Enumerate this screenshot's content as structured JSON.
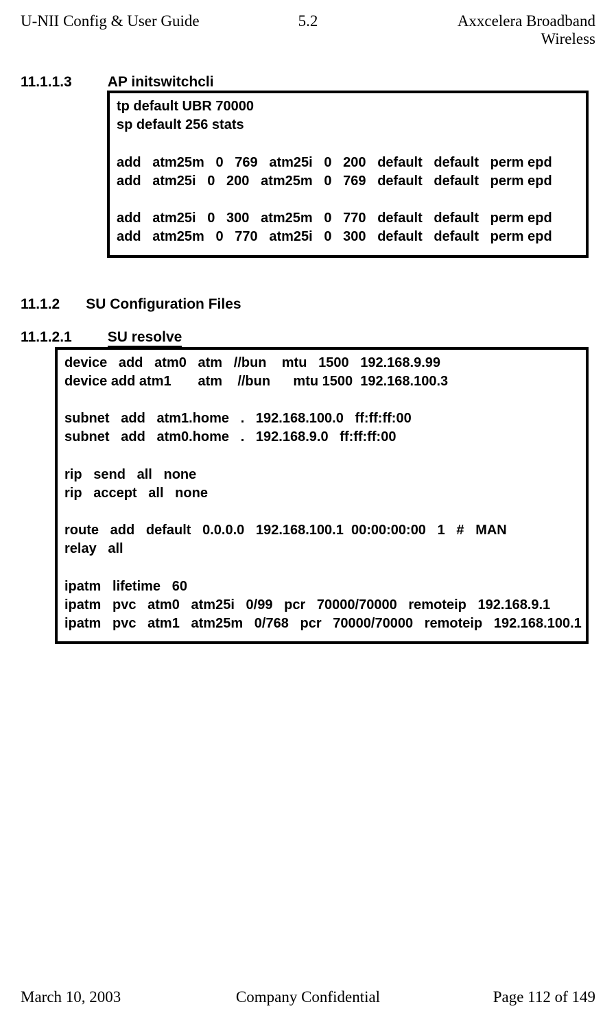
{
  "header": {
    "left": "U-NII Config & User Guide",
    "center": "5.2",
    "right": "Axxcelera Broadband Wireless"
  },
  "sections": {
    "s1": {
      "num": "11.1.1.3",
      "title": "AP initswitchcli"
    },
    "s2": {
      "num": "11.1.2",
      "title": "SU Configuration Files"
    },
    "s3": {
      "num": "11.1.2.1",
      "title": "SU resolve"
    }
  },
  "code1": "tp default UBR 70000\nsp default 256 stats\n\nadd   atm25m   0   769   atm25i   0   200   default   default   perm epd\nadd   atm25i   0   200   atm25m   0   769   default   default   perm epd\n\nadd   atm25i   0   300   atm25m   0   770   default   default   perm epd\nadd   atm25m   0   770   atm25i   0   300   default   default   perm epd\n",
  "code2": "device   add   atm0   atm   //bun    mtu   1500   192.168.9.99\ndevice add atm1       atm    //bun      mtu 1500  192.168.100.3\n\nsubnet   add   atm1.home   .   192.168.100.0   ff:ff:ff:00\nsubnet   add   atm0.home   .   192.168.9.0   ff:ff:ff:00\n\nrip   send   all   none\nrip   accept   all   none\n\nroute   add   default   0.0.0.0   192.168.100.1  00:00:00:00   1   #   MAN\nrelay   all\n\nipatm   lifetime   60\nipatm   pvc   atm0   atm25i   0/99   pcr   70000/70000   remoteip   192.168.9.1\nipatm   pvc   atm1   atm25m   0/768   pcr   70000/70000   remoteip   192.168.100.1",
  "footer": {
    "left": "March 10, 2003",
    "center": "Company Confidential",
    "right": "Page 112 of 149"
  }
}
